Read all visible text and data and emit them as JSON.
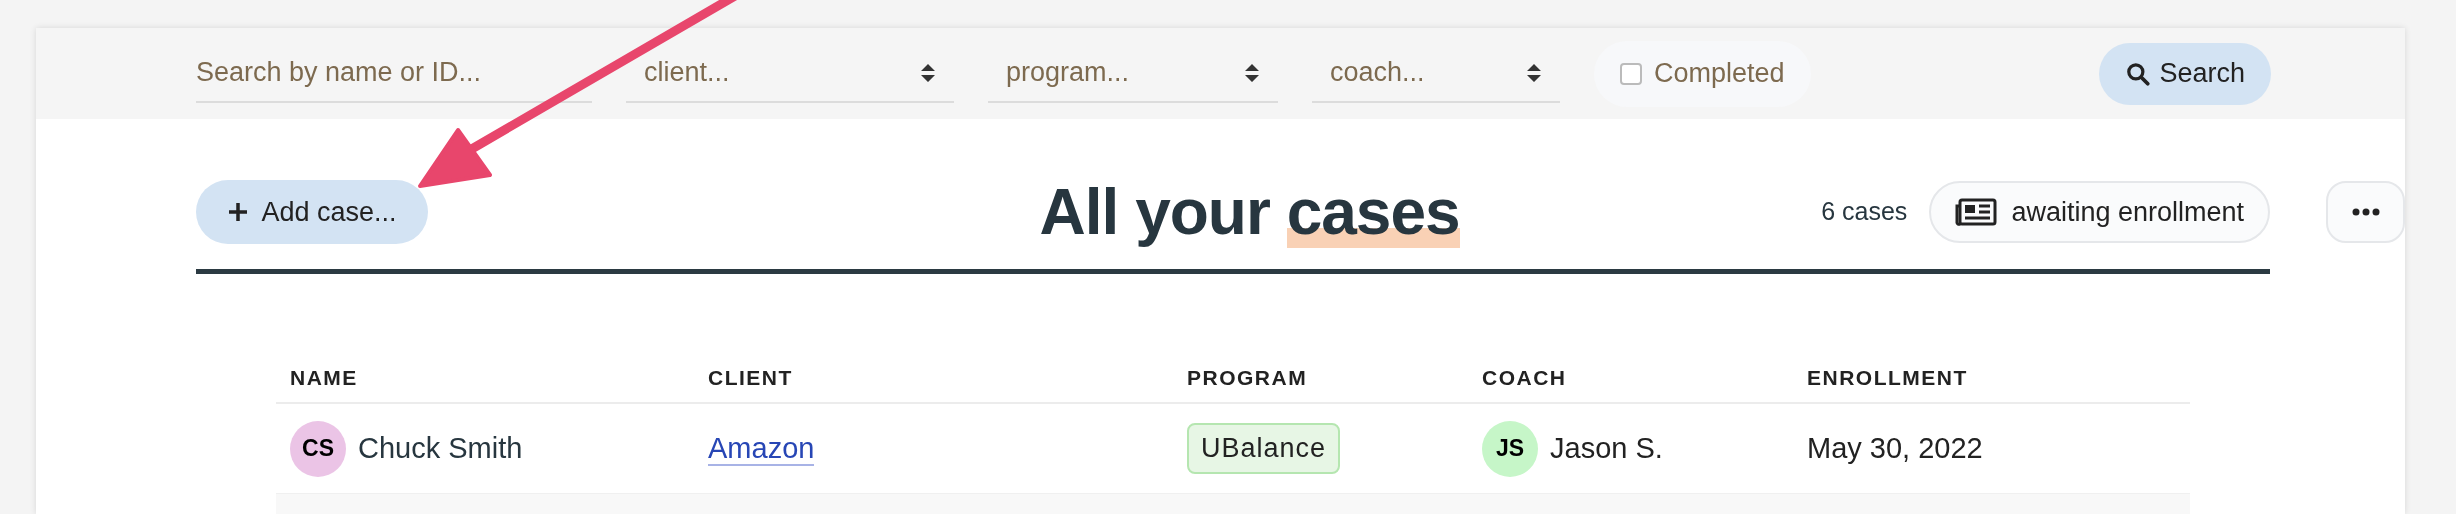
{
  "filters": {
    "search": {
      "placeholder": "Search by name or ID..."
    },
    "selects": [
      {
        "placeholder": "client..."
      },
      {
        "placeholder": "program..."
      },
      {
        "placeholder": "coach..."
      }
    ],
    "completed": {
      "label": "Completed",
      "checked": false
    },
    "search_button": "Search"
  },
  "add_button": "Add case...",
  "title": {
    "text": "All your",
    "highlight": "cases"
  },
  "count": "6 cases",
  "status_filter": "awaiting enrollment",
  "table": {
    "columns": [
      "NAME",
      "CLIENT",
      "PROGRAM",
      "COACH",
      "ENROLLMENT"
    ],
    "rows": [
      {
        "avatar": {
          "initials": "CS",
          "color": "#ebc4e6"
        },
        "name": "Chuck Smith",
        "client": "Amazon",
        "program": "UBalance",
        "coach_avatar": {
          "initials": "JS",
          "color": "#c6f6c8"
        },
        "coach": "Jason S.",
        "enrollment": "May 30, 2022"
      }
    ]
  }
}
